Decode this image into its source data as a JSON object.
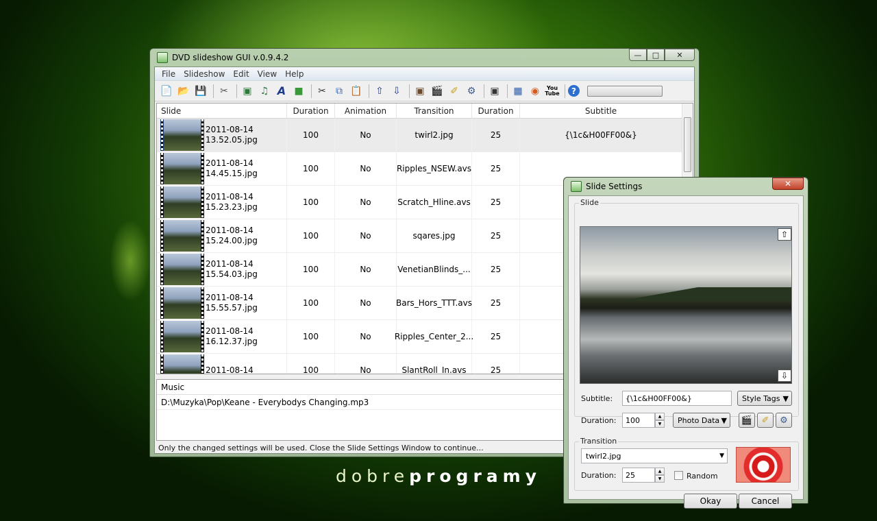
{
  "wallpaper": {
    "logo_light": "dobre",
    "logo_bold": "programy"
  },
  "main_window": {
    "title": "DVD slideshow GUI v.0.9.4.2",
    "menu": [
      "File",
      "Slideshow",
      "Edit",
      "View",
      "Help"
    ],
    "toolbar_icons": [
      "new-icon",
      "open-icon",
      "save-icon",
      "tools-icon",
      "add-image-icon",
      "add-audio-icon",
      "add-title-icon",
      "add-background-icon",
      "cut-icon",
      "copy-icon",
      "paste-icon",
      "move-up-icon",
      "move-down-icon",
      "slide-settings-icon",
      "clapper-icon",
      "brush-icon",
      "transition-icon",
      "preview-icon",
      "export-icon",
      "burn-icon",
      "youtube-icon",
      "help-icon"
    ],
    "columns": [
      "Slide",
      "Duration",
      "Animation",
      "Transition",
      "Duration",
      "Subtitle"
    ],
    "rows": [
      {
        "date": "2011-08-14",
        "time": "13.52.05.jpg",
        "duration": "100",
        "animation": "No",
        "transition": "twirl2.jpg",
        "tduration": "25",
        "subtitle": "{\\1c&H00FF00&}"
      },
      {
        "date": "2011-08-14",
        "time": "14.45.15.jpg",
        "duration": "100",
        "animation": "No",
        "transition": "Ripples_NSEW.avs",
        "tduration": "25",
        "subtitle": ""
      },
      {
        "date": "2011-08-14",
        "time": "15.23.23.jpg",
        "duration": "100",
        "animation": "No",
        "transition": "Scratch_Hline.avs",
        "tduration": "25",
        "subtitle": ""
      },
      {
        "date": "2011-08-14",
        "time": "15.24.00.jpg",
        "duration": "100",
        "animation": "No",
        "transition": "sqares.jpg",
        "tduration": "25",
        "subtitle": ""
      },
      {
        "date": "2011-08-14",
        "time": "15.54.03.jpg",
        "duration": "100",
        "animation": "No",
        "transition": "VenetianBlinds_...",
        "tduration": "25",
        "subtitle": ""
      },
      {
        "date": "2011-08-14",
        "time": "15.55.57.jpg",
        "duration": "100",
        "animation": "No",
        "transition": "Bars_Hors_TTT.avs",
        "tduration": "25",
        "subtitle": ""
      },
      {
        "date": "2011-08-14",
        "time": "16.12.37.jpg",
        "duration": "100",
        "animation": "No",
        "transition": "Ripples_Center_2...",
        "tduration": "25",
        "subtitle": ""
      },
      {
        "date": "2011-08-14",
        "time": "",
        "duration": "100",
        "animation": "No",
        "transition": "SlantRoll_In.avs",
        "tduration": "25",
        "subtitle": ""
      }
    ],
    "music_header": "Music",
    "music_file": "D:\\Muzyka\\Pop\\Keane  -  Everybodys Changing.mp3",
    "status": "Only the changed settings will be used. Close the Slide Settings Window to continue..."
  },
  "dialog": {
    "title": "Slide Settings",
    "slide_group": "Slide",
    "subtitle_label": "Subtitle:",
    "subtitle_value": "{\\1c&H00FF00&}",
    "style_tags": "Style Tags",
    "duration_label": "Duration:",
    "duration_value": "100",
    "photo_data": "Photo Data",
    "transition_group": "Transition",
    "transition_value": "twirl2.jpg",
    "tduration_label": "Duration:",
    "tduration_value": "25",
    "random_label": "Random",
    "okay": "Okay",
    "cancel": "Cancel"
  }
}
